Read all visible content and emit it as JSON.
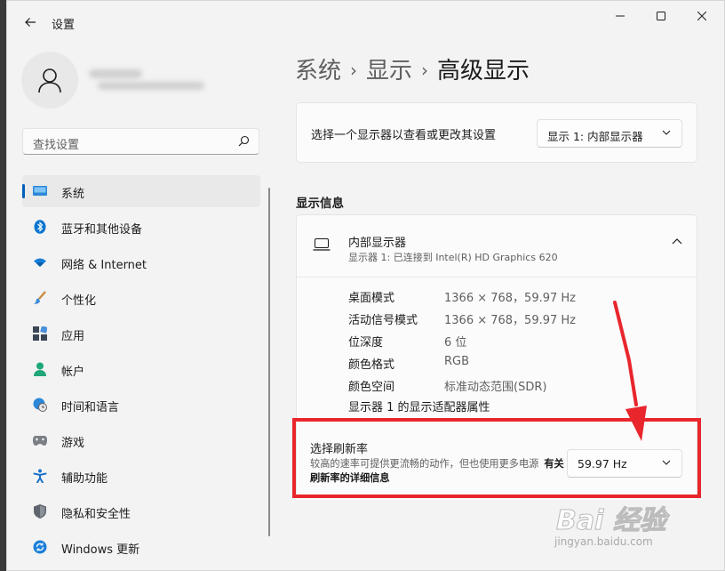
{
  "window": {
    "title": "设置",
    "controls": {
      "minimize": "minimize",
      "maximize": "maximize",
      "close": "close"
    }
  },
  "sidebar": {
    "search_placeholder": "查找设置",
    "items": [
      {
        "label": "系统",
        "icon": "system-icon",
        "active": true
      },
      {
        "label": "蓝牙和其他设备",
        "icon": "bluetooth-icon"
      },
      {
        "label": "网络 & Internet",
        "icon": "wifi-icon"
      },
      {
        "label": "个性化",
        "icon": "brush-icon"
      },
      {
        "label": "应用",
        "icon": "apps-icon"
      },
      {
        "label": "帐户",
        "icon": "account-icon"
      },
      {
        "label": "时间和语言",
        "icon": "globe-clock-icon"
      },
      {
        "label": "游戏",
        "icon": "gamepad-icon"
      },
      {
        "label": "辅助功能",
        "icon": "accessibility-icon"
      },
      {
        "label": "隐私和安全性",
        "icon": "shield-icon"
      },
      {
        "label": "Windows 更新",
        "icon": "update-icon"
      }
    ]
  },
  "breadcrumb": [
    "系统",
    "显示",
    "高级显示"
  ],
  "main": {
    "select_monitor": {
      "label": "选择一个显示器以查看或更改其设置",
      "value": "显示 1: 内部显示器"
    },
    "section_title": "显示信息",
    "monitor": {
      "name": "内部显示器",
      "subtitle": "显示器 1: 已连接到 Intel(R) HD Graphics 620",
      "specs": [
        {
          "key": "桌面模式",
          "value": "1366 × 768，59.97 Hz"
        },
        {
          "key": "活动信号模式",
          "value": "1366 × 768，59.97 Hz"
        },
        {
          "key": "位深度",
          "value": "6 位"
        },
        {
          "key": "颜色格式",
          "value": "RGB"
        },
        {
          "key": "颜色空间",
          "value": "标准动态范围(SDR)"
        }
      ],
      "adapter_link": "显示器 1 的显示适配器属性"
    },
    "refresh": {
      "title": "选择刷新率",
      "desc": "较高的速率可提供更流畅的动作，但也使用更多电源",
      "link": "有关刷新率的详细信息",
      "value": "59.97 Hz"
    }
  },
  "watermark": {
    "main": "Bai 经验",
    "sub": "jingyan.baidu.com"
  },
  "colors": {
    "accent": "#005fb8",
    "highlight": "#e8262c"
  }
}
